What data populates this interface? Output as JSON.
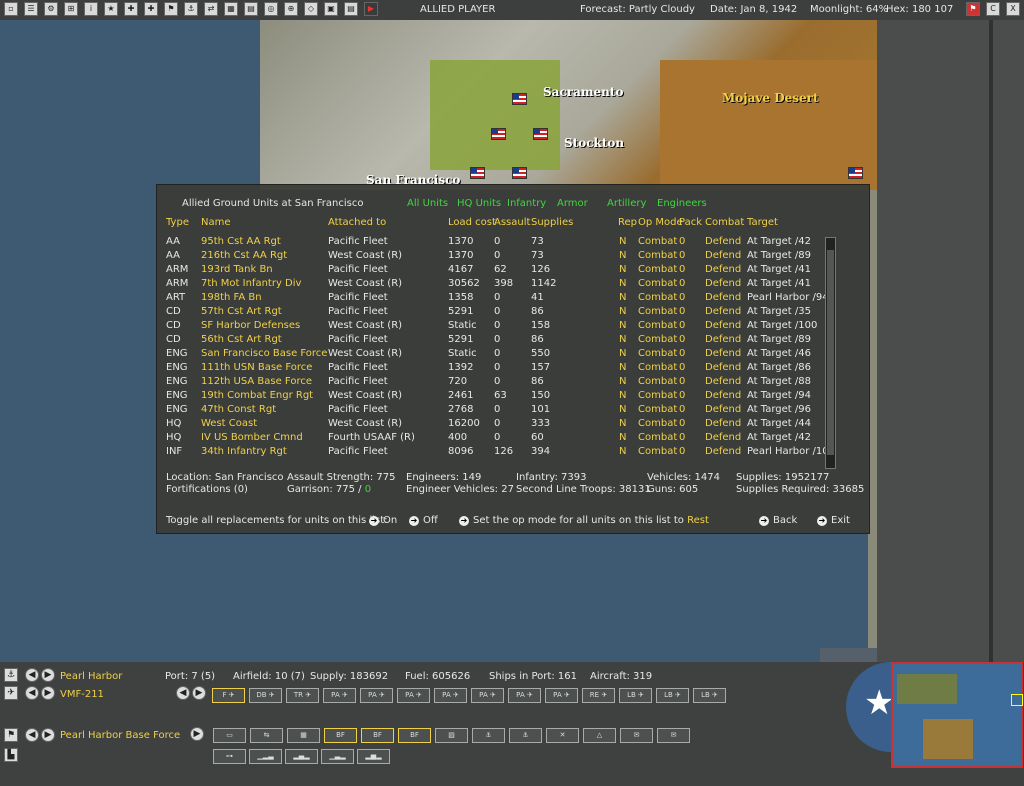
{
  "topbar": {
    "player": "ALLIED PLAYER",
    "forecast": "Forecast: Partly Cloudy",
    "date": "Date: Jan 8, 1942",
    "moonlight": "Moonlight: 64%",
    "hex": "Hex: 180 107",
    "help_label": "?",
    "close_label": "X",
    "c_label": "C"
  },
  "map": {
    "labels": {
      "sacramento": "Sacramento",
      "stockton": "Stockton",
      "san_francisco": "San Francisco",
      "mojave": "Mojave Desert"
    }
  },
  "dialog": {
    "title": "Allied Ground Units at San Francisco",
    "filters": [
      "All Units",
      "HQ Units",
      "Infantry",
      "Armor",
      "Artillery",
      "Engineers"
    ],
    "headers": {
      "type": "Type",
      "name": "Name",
      "attached": "Attached to",
      "load": "Load cost",
      "assault": "Assault",
      "supplies": "Supplies",
      "rep": "Rep",
      "opmode": "Op Mode",
      "pack": "Pack",
      "combat": "Combat",
      "target": "Target"
    },
    "units": [
      {
        "type": "AA",
        "name": "95th Cst AA Rgt",
        "attached": "Pacific Fleet",
        "load": "1370",
        "assault": "0",
        "supplies": "73",
        "rep": "N",
        "opmode": "Combat",
        "pack": "0",
        "combat": "Defend",
        "target": "At Target /42"
      },
      {
        "type": "AA",
        "name": "216th Cst AA Rgt",
        "attached": "West Coast (R)",
        "load": "1370",
        "assault": "0",
        "supplies": "73",
        "rep": "N",
        "opmode": "Combat",
        "pack": "0",
        "combat": "Defend",
        "target": "At Target /89"
      },
      {
        "type": "ARM",
        "name": "193rd Tank Bn",
        "attached": "Pacific Fleet",
        "load": "4167",
        "assault": "62",
        "supplies": "126",
        "rep": "N",
        "opmode": "Combat",
        "pack": "0",
        "combat": "Defend",
        "target": "At Target /41"
      },
      {
        "type": "ARM",
        "name": "7th Mot Infantry Div",
        "attached": "West Coast (R)",
        "load": "30562",
        "assault": "398",
        "supplies": "1142",
        "rep": "N",
        "opmode": "Combat",
        "pack": "0",
        "combat": "Defend",
        "target": "At Target /41"
      },
      {
        "type": "ART",
        "name": "198th FA Bn",
        "attached": "Pacific Fleet",
        "load": "1358",
        "assault": "0",
        "supplies": "41",
        "rep": "N",
        "opmode": "Combat",
        "pack": "0",
        "combat": "Defend",
        "target": "Pearl Harbor /94"
      },
      {
        "type": "CD",
        "name": "57th Cst Art Rgt",
        "attached": "Pacific Fleet",
        "load": "5291",
        "assault": "0",
        "supplies": "86",
        "rep": "N",
        "opmode": "Combat",
        "pack": "0",
        "combat": "Defend",
        "target": "At Target /35"
      },
      {
        "type": "CD",
        "name": "SF Harbor Defenses",
        "attached": "West Coast (R)",
        "load": "Static",
        "assault": "0",
        "supplies": "158",
        "rep": "N",
        "opmode": "Combat",
        "pack": "0",
        "combat": "Defend",
        "target": "At Target /100"
      },
      {
        "type": "CD",
        "name": "56th Cst Art Rgt",
        "attached": "Pacific Fleet",
        "load": "5291",
        "assault": "0",
        "supplies": "86",
        "rep": "N",
        "opmode": "Combat",
        "pack": "0",
        "combat": "Defend",
        "target": "At Target /89"
      },
      {
        "type": "ENG",
        "name": "San Francisco Base Force",
        "attached": "West Coast (R)",
        "load": "Static",
        "assault": "0",
        "supplies": "550",
        "rep": "N",
        "opmode": "Combat",
        "pack": "0",
        "combat": "Defend",
        "target": "At Target /46"
      },
      {
        "type": "ENG",
        "name": "111th USN Base Force",
        "attached": "Pacific Fleet",
        "load": "1392",
        "assault": "0",
        "supplies": "157",
        "rep": "N",
        "opmode": "Combat",
        "pack": "0",
        "combat": "Defend",
        "target": "At Target /86"
      },
      {
        "type": "ENG",
        "name": "112th USA Base Force",
        "attached": "Pacific Fleet",
        "load": "720",
        "assault": "0",
        "supplies": "86",
        "rep": "N",
        "opmode": "Combat",
        "pack": "0",
        "combat": "Defend",
        "target": "At Target /88"
      },
      {
        "type": "ENG",
        "name": "19th Combat Engr Rgt",
        "attached": "West Coast (R)",
        "load": "2461",
        "assault": "63",
        "supplies": "150",
        "rep": "N",
        "opmode": "Combat",
        "pack": "0",
        "combat": "Defend",
        "target": "At Target /94"
      },
      {
        "type": "ENG",
        "name": "47th Const Rgt",
        "attached": "Pacific Fleet",
        "load": "2768",
        "assault": "0",
        "supplies": "101",
        "rep": "N",
        "opmode": "Combat",
        "pack": "0",
        "combat": "Defend",
        "target": "At Target /96"
      },
      {
        "type": "HQ",
        "name": "West Coast",
        "attached": "West Coast (R)",
        "load": "16200",
        "assault": "0",
        "supplies": "333",
        "rep": "N",
        "opmode": "Combat",
        "pack": "0",
        "combat": "Defend",
        "target": "At Target /44"
      },
      {
        "type": "HQ",
        "name": "IV US Bomber Cmnd",
        "attached": "Fourth USAAF (R)",
        "load": "400",
        "assault": "0",
        "supplies": "60",
        "rep": "N",
        "opmode": "Combat",
        "pack": "0",
        "combat": "Defend",
        "target": "At Target /42"
      },
      {
        "type": "INF",
        "name": "34th Infantry Rgt",
        "attached": "Pacific Fleet",
        "load": "8096",
        "assault": "126",
        "supplies": "394",
        "rep": "N",
        "opmode": "Combat",
        "pack": "0",
        "combat": "Defend",
        "target": "Pearl Harbor /10("
      }
    ],
    "summary": {
      "location": "Location: San Francisco",
      "fortifications": "Fortifications (0)",
      "assault_strength": "Assault Strength: 775",
      "garrison": "Garrison: 775  /",
      "garrison_req": "0",
      "engineers": "Engineers: 149",
      "engineer_vehicles": "Engineer Vehicles: 27",
      "infantry": "Infantry: 7393",
      "second_line": "Second Line Troops: 38131",
      "vehicles": "Vehicles: 1474",
      "guns": "Guns: 605",
      "supplies": "Supplies: 1952177",
      "supplies_required": "Supplies Required: 33685"
    },
    "footer": {
      "toggle_text": "Toggle all replacements for units on this list:",
      "on": "On",
      "off": "Off",
      "opmode_text": "Set the op mode for all units on this list to",
      "opmode_value": "Rest",
      "back": "Back",
      "exit": "Exit"
    }
  },
  "bottom": {
    "base_name": "Pearl Harbor",
    "port": "Port: 7 (5)",
    "airfield": "Airfield: 10 (7)",
    "supply": "Supply: 183692",
    "fuel": "Fuel: 605626",
    "ships": "Ships in Port: 161",
    "aircraft": "Aircraft: 319",
    "air_unit": "VMF-211",
    "ground_unit": "Pearl Harbor Base Force",
    "air_slots": [
      "F",
      "DB",
      "TR",
      "PA",
      "PA",
      "PA",
      "PA",
      "PA",
      "PA",
      "PA",
      "RE",
      "LB",
      "LB",
      "LB"
    ],
    "ground_slots": [
      "",
      "",
      "",
      "BF",
      "BF",
      "BF",
      "",
      "",
      "",
      "",
      "",
      "",
      ""
    ]
  }
}
